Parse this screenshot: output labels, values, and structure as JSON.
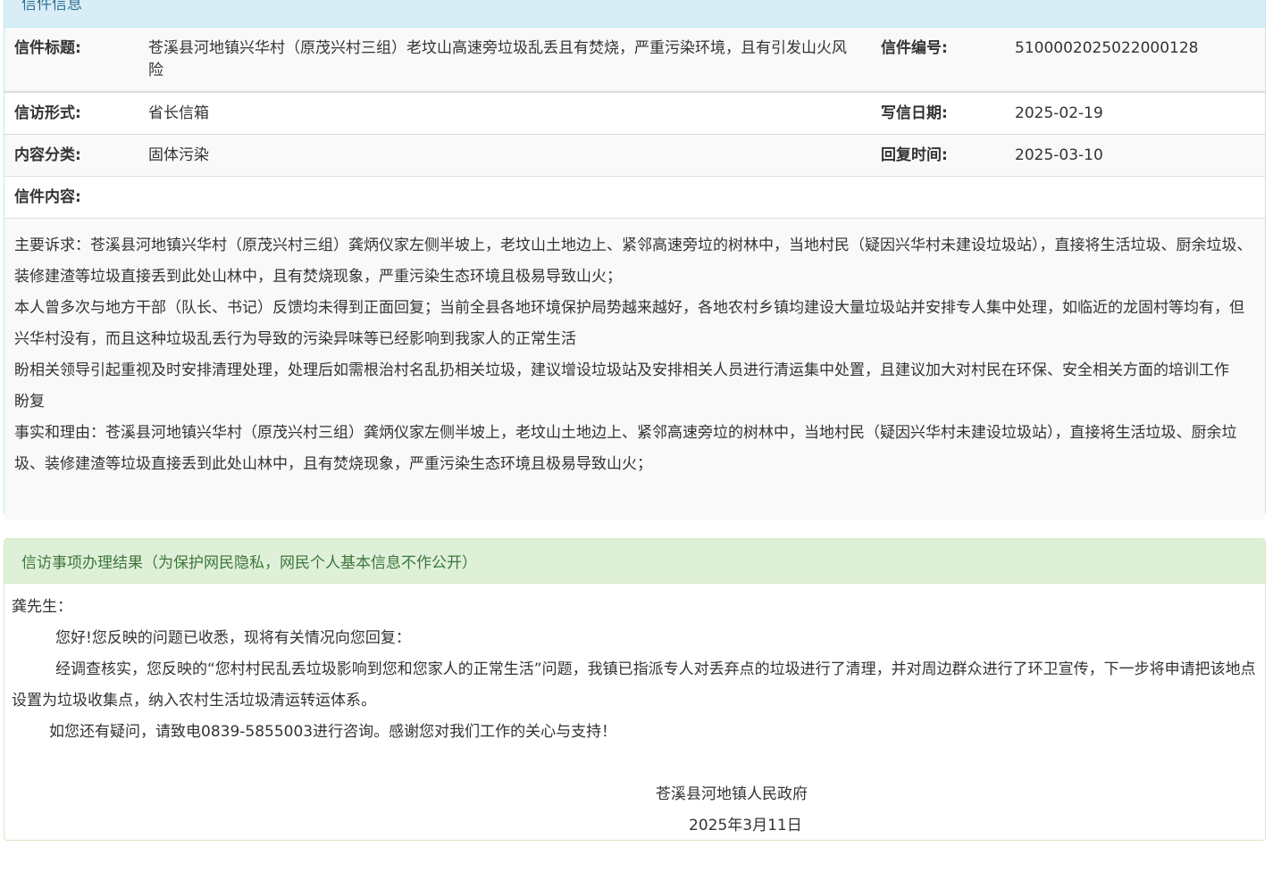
{
  "letter_panel": {
    "heading": "信件信息",
    "title_label": "信件标题:",
    "title_value": "苍溪县河地镇兴华村（原茂兴村三组）老坟山高速旁垃圾乱丢且有焚烧，严重污染环境，且有引发山火风险",
    "number_label": "信件编号:",
    "number_value": "5100002025022000128",
    "form_label": "信访形式:",
    "form_value": "省长信箱",
    "write_date_label": "写信日期:",
    "write_date_value": "2025-02-19",
    "category_label": "内容分类:",
    "category_value": "固体污染",
    "reply_time_label": "回复时间:",
    "reply_time_value": "2025-03-10",
    "content_label": "信件内容:",
    "content_paragraphs": [
      "主要诉求：苍溪县河地镇兴华村（原茂兴村三组）龚炳仪家左侧半坡上，老坟山土地边上、紧邻高速旁垃的树林中，当地村民（疑因兴华村未建设垃圾站），直接将生活垃圾、厨余垃圾、装修建渣等垃圾直接丢到此处山林中，且有焚烧现象，严重污染生态环境且极易导致山火；",
      "本人曾多次与地方干部（队长、书记）反馈均未得到正面回复；当前全县各地环境保护局势越来越好，各地农村乡镇均建设大量垃圾站并安排专人集中处理，如临近的龙固村等均有，但兴华村没有，而且这种垃圾乱丢行为导致的污染异味等已经影响到我家人的正常生活",
      "盼相关领导引起重视及时安排清理处理，处理后如需根治村名乱扔相关垃圾，建议增设垃圾站及安排相关人员进行清运集中处置，且建议加大对村民在环保、安全相关方面的培训工作",
      "盼复",
      "事实和理由：苍溪县河地镇兴华村（原茂兴村三组）龚炳仪家左侧半坡上，老坟山土地边上、紧邻高速旁垃的树林中，当地村民（疑因兴华村未建设垃圾站），直接将生活垃圾、厨余垃圾、装修建渣等垃圾直接丢到此处山林中，且有焚烧现象，严重污染生态环境且极易导致山火；"
    ]
  },
  "result_panel": {
    "heading": "信访事项办理结果（为保护网民隐私，网民个人基本信息不作公开）",
    "salutation": "龚先生：",
    "p1": "您好!您反映的问题已收悉，现将有关情况向您回复：",
    "p2": "经调查核实，您反映的“您村村民乱丢垃圾影响到您和您家人的正常生活”问题，我镇已指派专人对丢弃点的垃圾进行了清理，并对周边群众进行了环卫宣传，下一步将申请把该地点设置为垃圾收集点，纳入农村生活垃圾清运转运体系。",
    "p3": "如您还有疑问，请致电0839-5855003进行咨询。感谢您对我们工作的关心与支持！",
    "signature": "苍溪县河地镇人民政府",
    "date": "2025年3月11日"
  }
}
